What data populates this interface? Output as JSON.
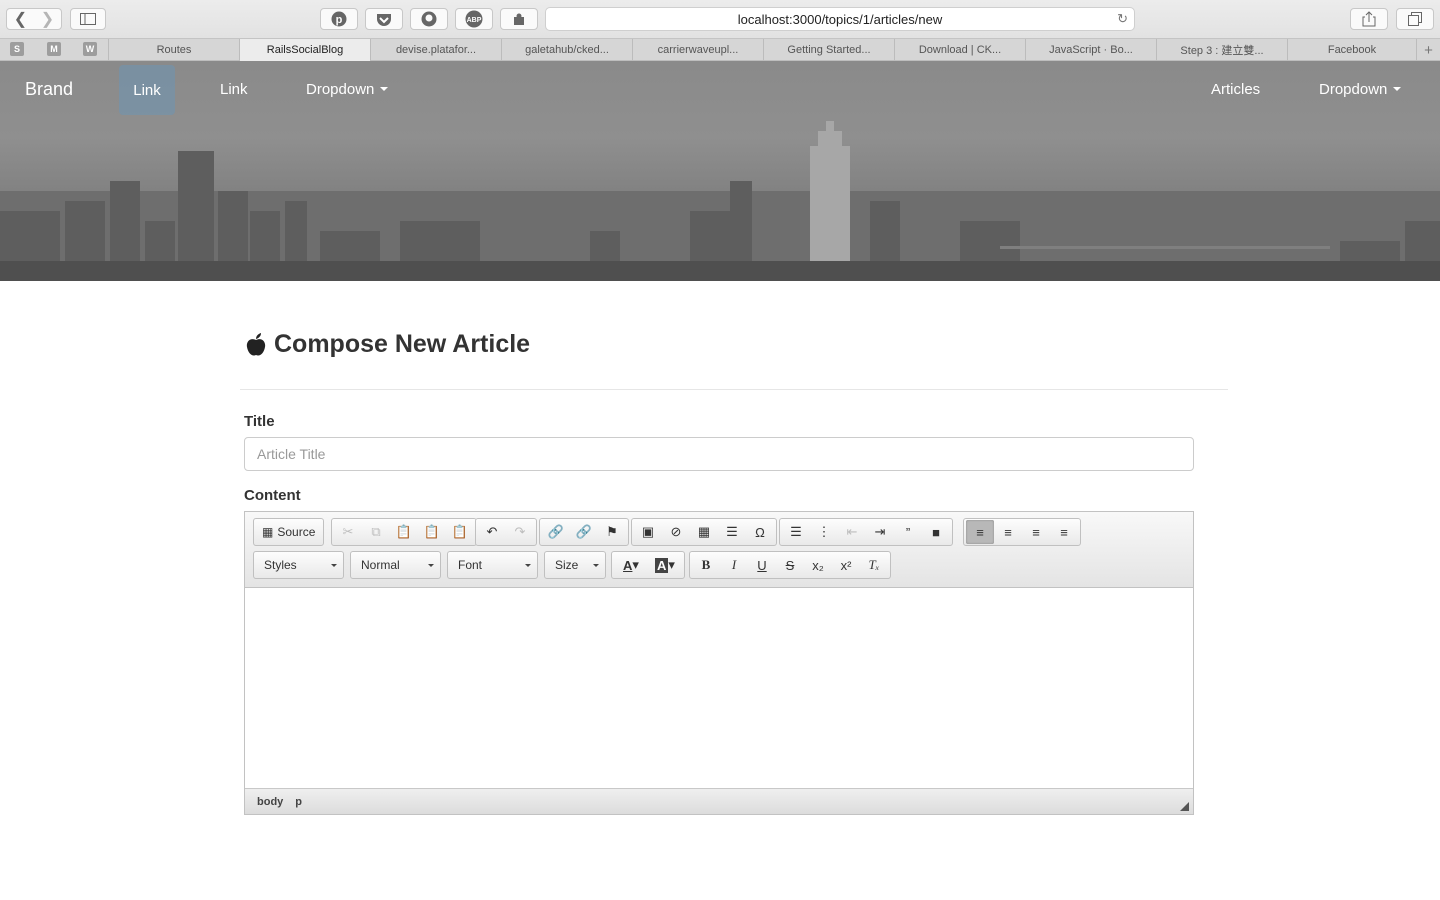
{
  "browser": {
    "url": "localhost:3000/topics/1/articles/new",
    "bookmarks": [
      "S",
      "M",
      "W"
    ],
    "tabs": [
      {
        "label": "Routes",
        "active": false
      },
      {
        "label": "RailsSocialBlog",
        "active": true
      },
      {
        "label": "devise.platafor...",
        "active": false
      },
      {
        "label": "galetahub/cked...",
        "active": false
      },
      {
        "label": "carrierwaveupl...",
        "active": false
      },
      {
        "label": "Getting Started...",
        "active": false
      },
      {
        "label": "Download | CK...",
        "active": false
      },
      {
        "label": "JavaScript · Bo...",
        "active": false
      },
      {
        "label": "Step 3 : 建立雙...",
        "active": false
      },
      {
        "label": "Facebook",
        "active": false
      }
    ]
  },
  "navbar": {
    "brand": "Brand",
    "left": [
      "Link",
      "Link",
      "Dropdown"
    ],
    "right": [
      "Articles",
      "Dropdown"
    ]
  },
  "page": {
    "title": "Compose New Article",
    "title_label": "Title",
    "title_placeholder": "Article Title",
    "content_label": "Content"
  },
  "editor": {
    "source_label": "Source",
    "combos": [
      "Styles",
      "Normal",
      "Font",
      "Size"
    ],
    "path": [
      "body",
      "p"
    ]
  }
}
